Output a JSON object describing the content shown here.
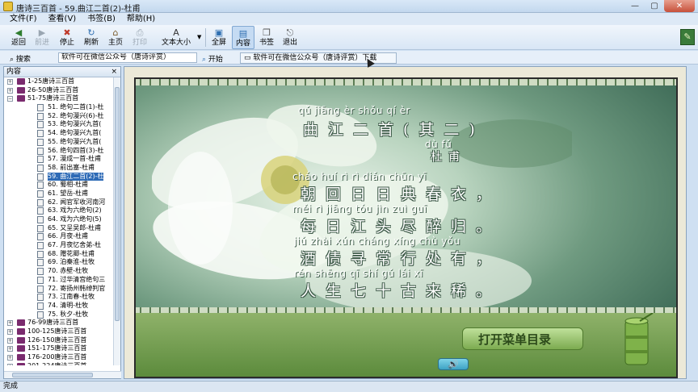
{
  "window": {
    "title": "唐诗三百首 - 59.曲江二首(2)-杜甫",
    "controls": {
      "minimize": "—",
      "maximize": "▢",
      "close": "✕"
    }
  },
  "menu": [
    "文件(F)",
    "查看(V)",
    "书签(B)",
    "帮助(H)"
  ],
  "toolbar": {
    "back": "返回",
    "forward": "前进",
    "stop": "停止",
    "refresh": "刷新",
    "home": "主页",
    "print": "打印",
    "textsize": "文本大小",
    "fullscreen": "全屏",
    "content": "内容",
    "bookmark": "书签",
    "exit": "退出"
  },
  "search": {
    "label": "搜索",
    "value": "软件可在微信公众号（唐诗评赏）",
    "go": "开始",
    "note": "软件可在微信公众号（唐诗评赏）下载"
  },
  "sidebar": {
    "title": "内容",
    "close": "×",
    "groups_top": [
      {
        "label": "1-25唐诗三百首",
        "expander": "+"
      },
      {
        "label": "26-50唐诗三百首",
        "expander": "+"
      },
      {
        "label": "51-75唐诗三百首",
        "expander": "−"
      }
    ],
    "items": [
      "51. 绝句二首(1)-杜",
      "52. 绝句漫兴(6)-杜",
      "53. 绝句漫兴九首(",
      "54. 绝句漫兴九首(",
      "55. 绝句漫兴九首(",
      "56. 绝句四首(3)-杜",
      "57. 漫成一首-杜甫",
      "58. 前出塞-杜甫",
      "59. 曲江二首(2)-杜",
      "60. 蜀相-杜甫",
      "61. 望岳-杜甫",
      "62. 闻官军收河南河",
      "63. 戏为六绝句(2)",
      "64. 戏为六绝句(5)",
      "65. 又呈吴郎-杜甫",
      "66. 月夜-杜甫",
      "67. 月夜忆舍弟-杜",
      "68. 赠花卿-杜甫",
      "69. 泊秦淮-杜牧",
      "70. 赤壁-杜牧",
      "71. 过华清宫绝句三",
      "72. 寄扬州韩绰判官",
      "73. 江南春-杜牧",
      "74. 清明-杜牧",
      "75. 秋夕-杜牧"
    ],
    "selected_index": 8,
    "groups_bottom": [
      {
        "label": "76-99唐诗三百首",
        "expander": "+"
      },
      {
        "label": "100-125唐诗三百首",
        "expander": "+"
      },
      {
        "label": "126-150唐诗三百首",
        "expander": "+"
      },
      {
        "label": "151-175唐诗三百首",
        "expander": "+"
      },
      {
        "label": "176-200唐诗三百首",
        "expander": "+"
      },
      {
        "label": "201-224唐诗三百首",
        "expander": "+"
      }
    ]
  },
  "poem": {
    "title_pinyin": "qǔ   jiāng   èr   shǒu         qí   èr",
    "title": "曲江二首(其二)",
    "author_pinyin": "dù   fǔ",
    "author": "杜甫",
    "lines": [
      {
        "pinyin": "cháo huí    rì    rì   diǎn chūn   yī",
        "text": "朝回日日典春衣，"
      },
      {
        "pinyin": "měi   rì   jiāng tóu   jìn   zuì   guī",
        "text": "每日江头尽醉归。"
      },
      {
        "pinyin": "jiǔ  zhài  xún cháng xíng chù  yǒu",
        "text": "酒债寻常行处有，"
      },
      {
        "pinyin": "rén shēng  qī    shí   gǔ   lái   xī",
        "text": "人生七十古来稀。"
      }
    ]
  },
  "scene": {
    "menu_button": "打开菜单目录",
    "speaker_icon": "speaker-icon"
  },
  "status": "完成",
  "colors": {
    "accent": "#2d6ab6",
    "scene_green": "#5c8b3c"
  }
}
